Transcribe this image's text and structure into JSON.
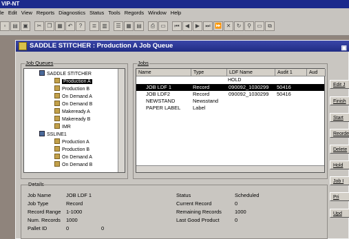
{
  "app": {
    "title": "VIP-NT"
  },
  "menu": [
    "le",
    "Edit",
    "View",
    "Reports",
    "Diagnostics",
    "Status",
    "Tools",
    "Regords",
    "Window",
    "Help"
  ],
  "window": {
    "title": "SADDLE STITCHER : Production A Job Queue"
  },
  "job_queues": {
    "label": "Job Queues",
    "items": [
      {
        "label": "SADDLE STITCHER",
        "type": "system"
      },
      {
        "label": "Production A",
        "type": "queue",
        "selected": true
      },
      {
        "label": "Production B",
        "type": "queue"
      },
      {
        "label": "On Demand A",
        "type": "queue"
      },
      {
        "label": "On Demand B",
        "type": "queue"
      },
      {
        "label": "Makeready A",
        "type": "queue"
      },
      {
        "label": "Makeready B",
        "type": "queue"
      },
      {
        "label": "IMR",
        "type": "queue"
      },
      {
        "label": "SSLINE1",
        "type": "system"
      },
      {
        "label": "Production A",
        "type": "queue"
      },
      {
        "label": "Production B",
        "type": "queue"
      },
      {
        "label": "On Demand A",
        "type": "queue"
      },
      {
        "label": "On Demand B",
        "type": "queue"
      }
    ]
  },
  "jobs": {
    "label": "Jobs",
    "columns": [
      "Name",
      "Type",
      "LDF Name",
      "Audit 1",
      "Aud"
    ],
    "hold": "HOLD",
    "rows": [
      {
        "name": "JOB LDF 1",
        "type": "Record",
        "ldf": "090092_1030299",
        "audit": "50416",
        "selected": true
      },
      {
        "name": "JOB LDF2",
        "type": "Record",
        "ldf": "090092_1030299",
        "audit": "50416"
      },
      {
        "name": "NEWSTAND",
        "type": "Newsstand",
        "ldf": "",
        "audit": ""
      },
      {
        "name": "PAPER LABEL",
        "type": "Label",
        "ldf": "",
        "audit": ""
      }
    ]
  },
  "side_buttons": [
    "Edit J",
    "Finish",
    "Start",
    "Reorde",
    "Delete",
    "Hold",
    "Job I",
    "Pri",
    "Upd"
  ],
  "details": {
    "label": "Details",
    "left": [
      {
        "k": "Job Name",
        "v": "JOB LDF 1"
      },
      {
        "k": "Job Type",
        "v": "Record"
      },
      {
        "k": "Record Range",
        "v": "1-1000"
      },
      {
        "k": "Num. Records",
        "v": "1000"
      },
      {
        "k": "Pallet ID",
        "v": "0",
        "v2": "0"
      }
    ],
    "right": [
      {
        "k": "Status",
        "v": "Scheduled"
      },
      {
        "k": "Current Record",
        "v": "0"
      },
      {
        "k": "Remaining Records",
        "v": "1000"
      },
      {
        "k": "Last Good Product",
        "v": "0"
      }
    ]
  }
}
